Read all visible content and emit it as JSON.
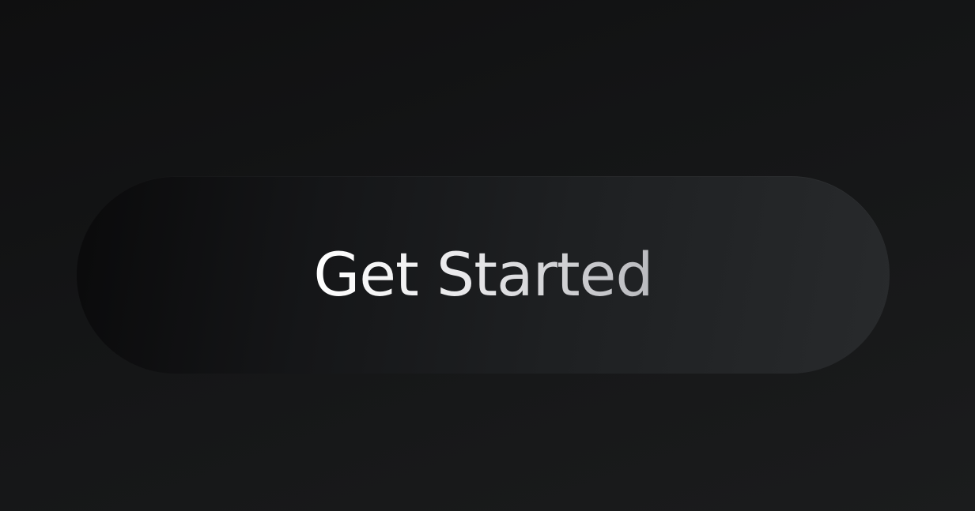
{
  "cta": {
    "label": "Get Started"
  },
  "colors": {
    "background_dark": "#0f0f10",
    "background_light": "#1b1c1d",
    "button_dark": "#0a0a0b",
    "button_light": "#282a2c",
    "label_start": "#ffffff",
    "label_end": "#b9babe"
  }
}
